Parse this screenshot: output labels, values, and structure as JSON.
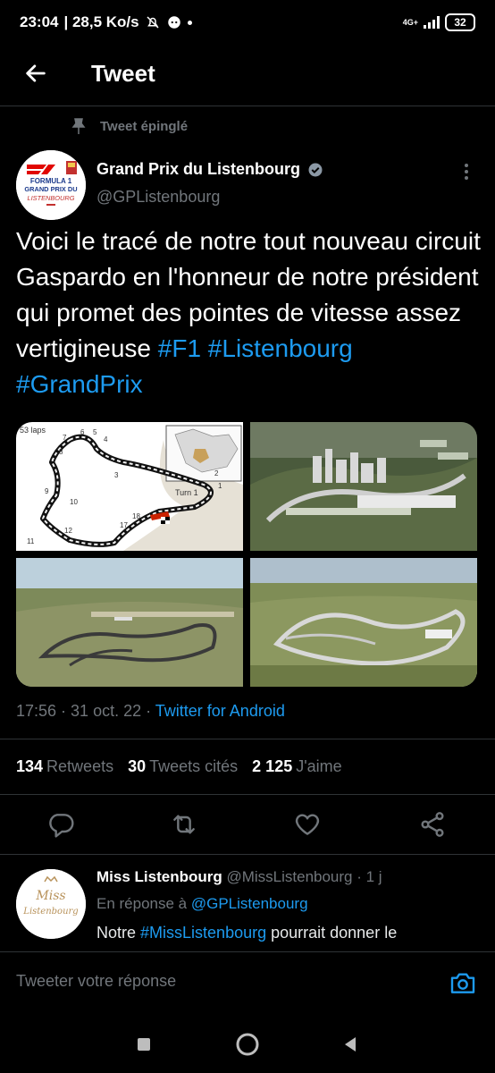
{
  "status_bar": {
    "time": "23:04",
    "speed": "| 28,5 Ko/s",
    "network": "4G+",
    "battery": "32"
  },
  "header": {
    "title": "Tweet"
  },
  "tweet": {
    "pinned_label": "Tweet épinglé",
    "author_name": "Grand Prix du Listenbourg",
    "author_handle": "@GPListenbourg",
    "avatar_lines": [
      "FORMULA 1",
      "GRAND PRIX DU",
      "LISTENBOURG"
    ],
    "text_main": "Voici le tracé de notre tout nouveau circuit Gaspardo en l'honneur de notre président qui promet des pointes de vitesse assez vertigineuse ",
    "hashtags": [
      "#F1",
      "#Listenbourg",
      "#GrandPrix"
    ],
    "map_labels": {
      "laps": "53 laps",
      "turn": "Turn 1",
      "numbers": [
        "1",
        "2",
        "3",
        "4",
        "5",
        "6",
        "7",
        "8",
        "9",
        "10",
        "11",
        "12",
        "17",
        "18"
      ]
    },
    "date": "17:56 · 31 oct. 22 · ",
    "source": "Twitter for Android",
    "stats": {
      "retweets_count": "134",
      "retweets_label": "Retweets",
      "quotes_count": "30",
      "quotes_label": "Tweets cités",
      "likes_count": "2 125",
      "likes_label": "J'aime"
    }
  },
  "reply": {
    "name": "Miss Listenbourg",
    "handle": "@MissListenbourg · 1 j",
    "context_prefix": "En réponse à ",
    "context_handle": "@GPListenbourg",
    "text_prefix": "Notre ",
    "text_hashtag": "#MissListenbourg",
    "text_suffix": " pourrait donner le",
    "avatar_text_top": "Miss",
    "avatar_text_bottom": "Listenbourg"
  },
  "composer": {
    "placeholder": "Tweeter votre réponse"
  },
  "colors": {
    "accent": "#1d9bf0",
    "muted": "#71767b",
    "background": "#000000"
  }
}
